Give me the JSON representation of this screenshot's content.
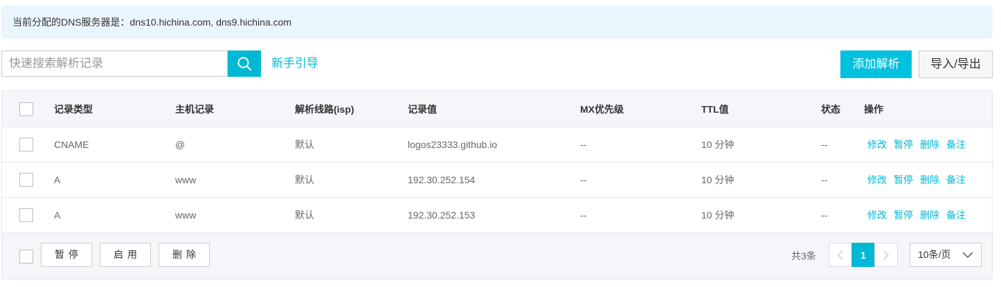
{
  "notice": {
    "text": "当前分配的DNS服务器是：dns10.hichina.com, dns9.hichina.com"
  },
  "toolbar": {
    "search_placeholder": "快速搜索解析记录",
    "search_icon": "search-icon",
    "guide_link": "新手引导",
    "add_button": "添加解析",
    "import_export_button": "导入/导出"
  },
  "table": {
    "columns": {
      "type": "记录类型",
      "host": "主机记录",
      "line": "解析线路(isp)",
      "value": "记录值",
      "mx": "MX优先级",
      "ttl": "TTL值",
      "status": "状态",
      "ops": "操作"
    },
    "rows": [
      {
        "type": "CNAME",
        "host": "@",
        "line": "默认",
        "value": "logos23333.github.io",
        "mx": "--",
        "ttl": "10 分钟",
        "status": "--"
      },
      {
        "type": "A",
        "host": "www",
        "line": "默认",
        "value": "192.30.252.154",
        "mx": "--",
        "ttl": "10 分钟",
        "status": "--"
      },
      {
        "type": "A",
        "host": "www",
        "line": "默认",
        "value": "192.30.252.153",
        "mx": "--",
        "ttl": "10 分钟",
        "status": "--"
      }
    ],
    "row_actions": {
      "edit": "修改",
      "pause": "暂停",
      "delete": "删除",
      "note": "备注"
    }
  },
  "footer": {
    "pause_button": "暂停",
    "enable_button": "启用",
    "delete_button": "删除",
    "total": "共3条",
    "current_page": "1",
    "page_size": "10条/页"
  },
  "colors": {
    "accent": "#00b8d4",
    "notice_bg": "#eaf6fd",
    "header_bg": "#f5f6fa"
  }
}
